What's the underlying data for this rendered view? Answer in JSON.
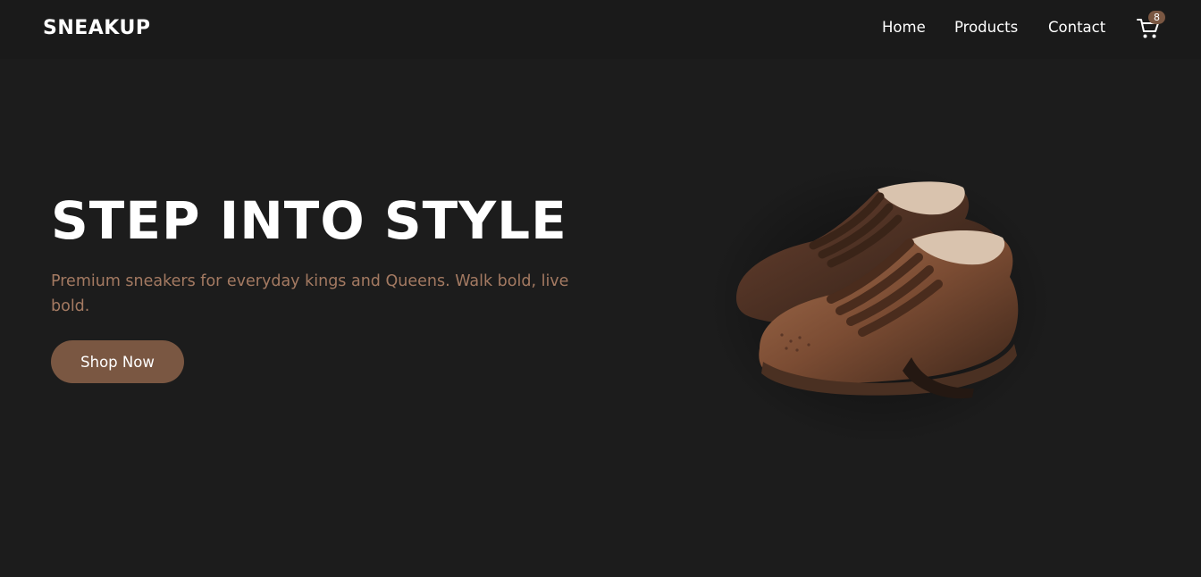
{
  "header": {
    "logo": "SNEAKUP",
    "nav": [
      {
        "label": "Home"
      },
      {
        "label": "Products"
      },
      {
        "label": "Contact"
      }
    ],
    "cart": {
      "icon": "cart-icon",
      "count": "8"
    }
  },
  "hero": {
    "title": "STEP INTO STYLE",
    "subtitle": "Premium sneakers for everyday kings and Queens. Walk bold, live bold.",
    "cta_label": "Shop Now",
    "image": "sneakers-image"
  },
  "colors": {
    "background": "#1c1c1c",
    "accent": "#7a5742",
    "subtitle_text": "#a47a62",
    "text": "#ffffff"
  }
}
